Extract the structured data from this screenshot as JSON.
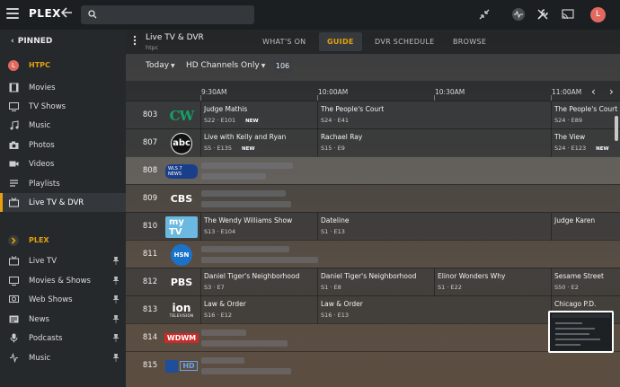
{
  "app": {
    "logo_text": "PLEX",
    "accent": "#e5a00d"
  },
  "topbar": {
    "search_placeholder": "",
    "avatar_letter": "L"
  },
  "sidebar": {
    "pinned_label": "PINNED",
    "htpc": {
      "server_avatar": "L",
      "server_name": "HTPC",
      "items": [
        {
          "label": "Movies",
          "icon": "film-icon"
        },
        {
          "label": "TV Shows",
          "icon": "tv-icon"
        },
        {
          "label": "Music",
          "icon": "music-note-icon"
        },
        {
          "label": "Photos",
          "icon": "camera-icon"
        },
        {
          "label": "Videos",
          "icon": "video-icon"
        },
        {
          "label": "Playlists",
          "icon": "playlist-icon"
        },
        {
          "label": "Live TV & DVR",
          "icon": "live-tv-icon",
          "active": true
        }
      ]
    },
    "plex": {
      "server_name": "PLEX",
      "items": [
        {
          "label": "Live TV",
          "icon": "tv-icon"
        },
        {
          "label": "Movies & Shows",
          "icon": "tv-icon"
        },
        {
          "label": "Web Shows",
          "icon": "web-tv-icon"
        },
        {
          "label": "News",
          "icon": "news-icon"
        },
        {
          "label": "Podcasts",
          "icon": "microphone-icon"
        },
        {
          "label": "Music",
          "icon": "music-icon"
        }
      ]
    }
  },
  "header": {
    "title": "Live TV & DVR",
    "subtitle": "htpc",
    "tabs": [
      {
        "label": "WHAT'S ON",
        "active": false
      },
      {
        "label": "GUIDE",
        "active": true
      },
      {
        "label": "DVR SCHEDULE",
        "active": false
      },
      {
        "label": "BROWSE",
        "active": false
      }
    ]
  },
  "filters": {
    "day": "Today",
    "channels": "HD Channels Only",
    "count": "106"
  },
  "timeline": {
    "times": [
      "9:30AM",
      "10:00AM",
      "10:30AM",
      "11:00AM"
    ]
  },
  "guide": {
    "rows": [
      {
        "num": "803",
        "logo": "CW",
        "programs": [
          {
            "title": "Judge Mathis",
            "sub": "S22 · E101",
            "new": "NEW"
          },
          {
            "title": "The People's Court",
            "sub": "S24 · E41"
          },
          {
            "title": "The People's Court",
            "sub": "S24 · E89"
          }
        ]
      },
      {
        "num": "807",
        "logo": "abc",
        "programs": [
          {
            "title": "Live with Kelly and Ryan",
            "sub": "S5 · E135",
            "new": "NEW"
          },
          {
            "title": "Rachael Ray",
            "sub": "S15 · E9"
          },
          {
            "title": "The View",
            "sub": "S24 · E123",
            "new": "NEW"
          }
        ]
      },
      {
        "num": "808",
        "logo": "WLS 7 NEWS"
      },
      {
        "num": "809",
        "logo": "CBS"
      },
      {
        "num": "810",
        "logo": "my TV",
        "programs": [
          {
            "title": "The Wendy Williams Show",
            "sub": "S13 · E104"
          },
          {
            "title": "Dateline",
            "sub": "S1 · E13"
          },
          {
            "title": "Judge Karen",
            "sub": ""
          }
        ]
      },
      {
        "num": "811",
        "logo": "HSN"
      },
      {
        "num": "812",
        "logo": "PBS",
        "programs": [
          {
            "title": "Daniel Tiger's Neighborhood",
            "sub": "S3 · E7"
          },
          {
            "title": "Daniel Tiger's Neighborhood",
            "sub": "S1 · E8"
          },
          {
            "title": "Elinor Wonders Why",
            "sub": "S1 · E22"
          },
          {
            "title": "Sesame Street",
            "sub": "S50 · E2"
          }
        ]
      },
      {
        "num": "813",
        "logo": "ion",
        "logo_sub": "TELEVISION",
        "programs": [
          {
            "title": "Law & Order",
            "sub": "S16 · E12"
          },
          {
            "title": "Law & Order",
            "sub": "S16 · E13"
          },
          {
            "title": "Chicago P.D.",
            "sub": ""
          }
        ]
      },
      {
        "num": "814",
        "logo": "WDWM"
      },
      {
        "num": "815",
        "logo": "HD"
      }
    ]
  }
}
